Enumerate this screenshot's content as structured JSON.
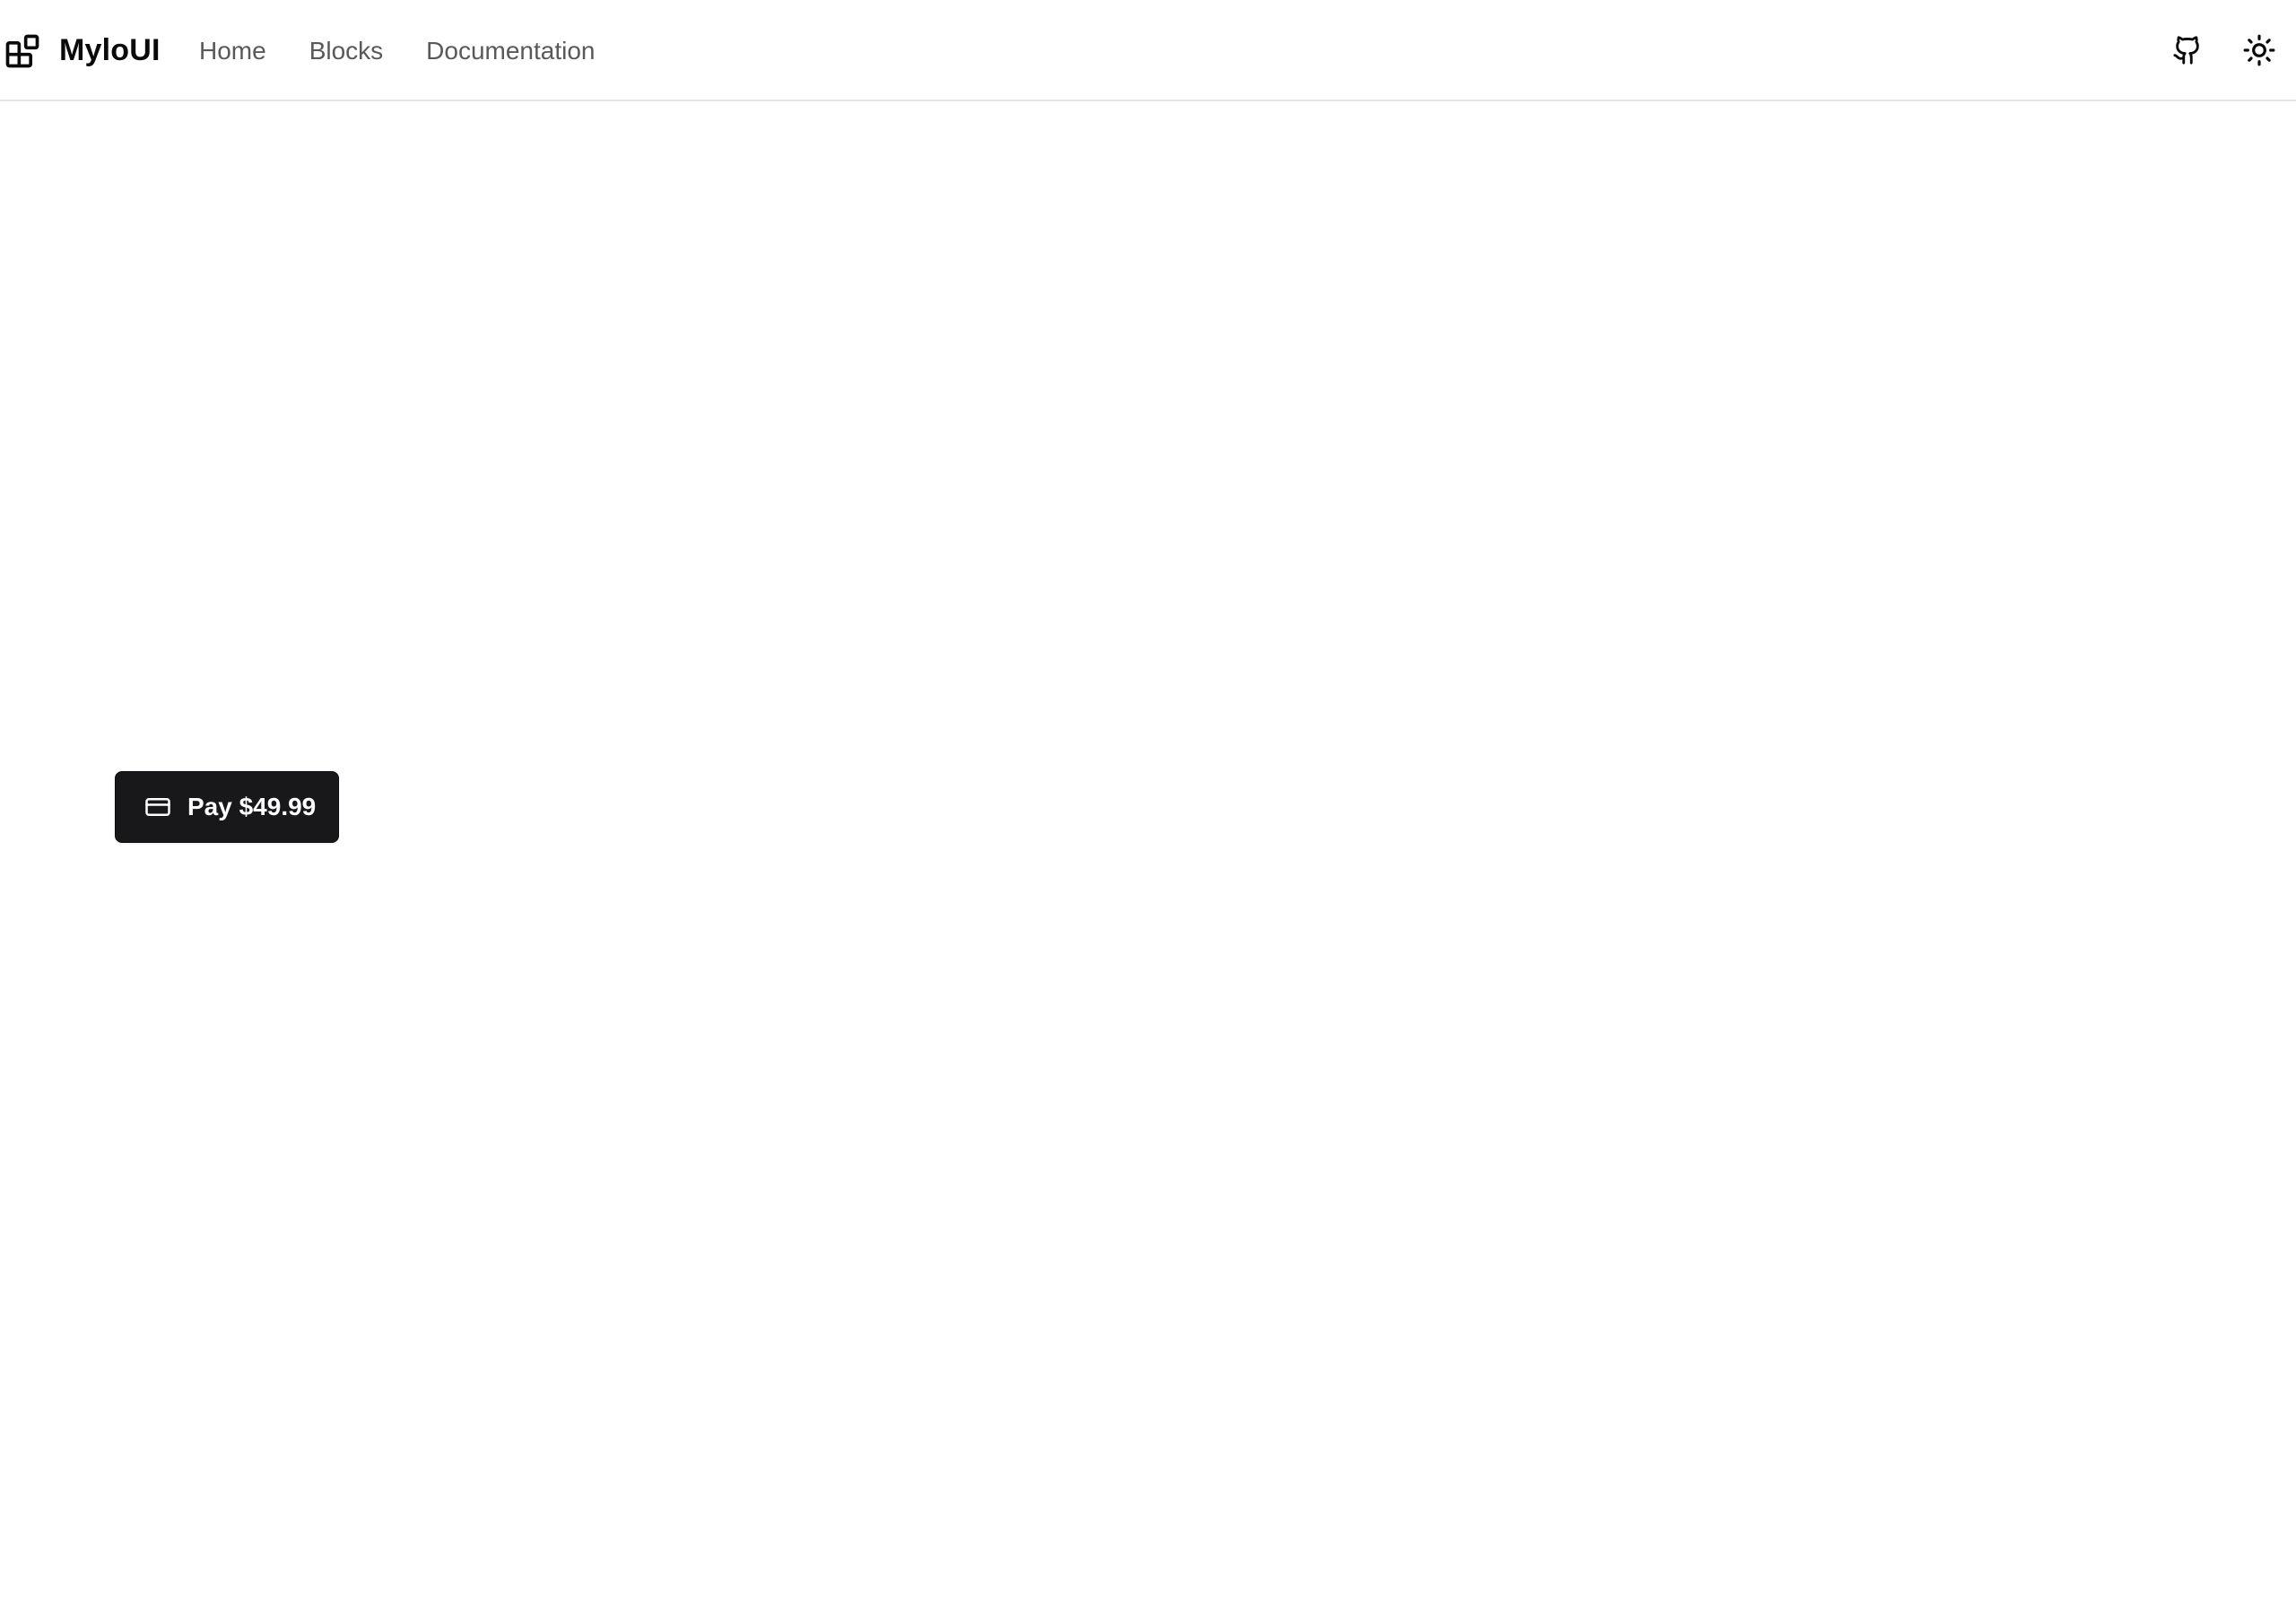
{
  "header": {
    "brand": {
      "name": "MyloUI",
      "logo_icon": "blocks-logo-icon"
    },
    "nav": [
      {
        "label": "Home"
      },
      {
        "label": "Blocks"
      },
      {
        "label": "Documentation"
      }
    ],
    "actions": {
      "github_icon": "github-icon",
      "theme_icon": "sun-icon"
    }
  },
  "main": {
    "pay_button": {
      "label": "Pay $49.99",
      "icon": "credit-card-icon"
    }
  },
  "colors": {
    "background": "#ffffff",
    "text_primary": "#0a0a0a",
    "nav_text": "#595959",
    "border": "#e4e4e7",
    "button_bg": "#18181b",
    "button_text": "#ffffff"
  }
}
